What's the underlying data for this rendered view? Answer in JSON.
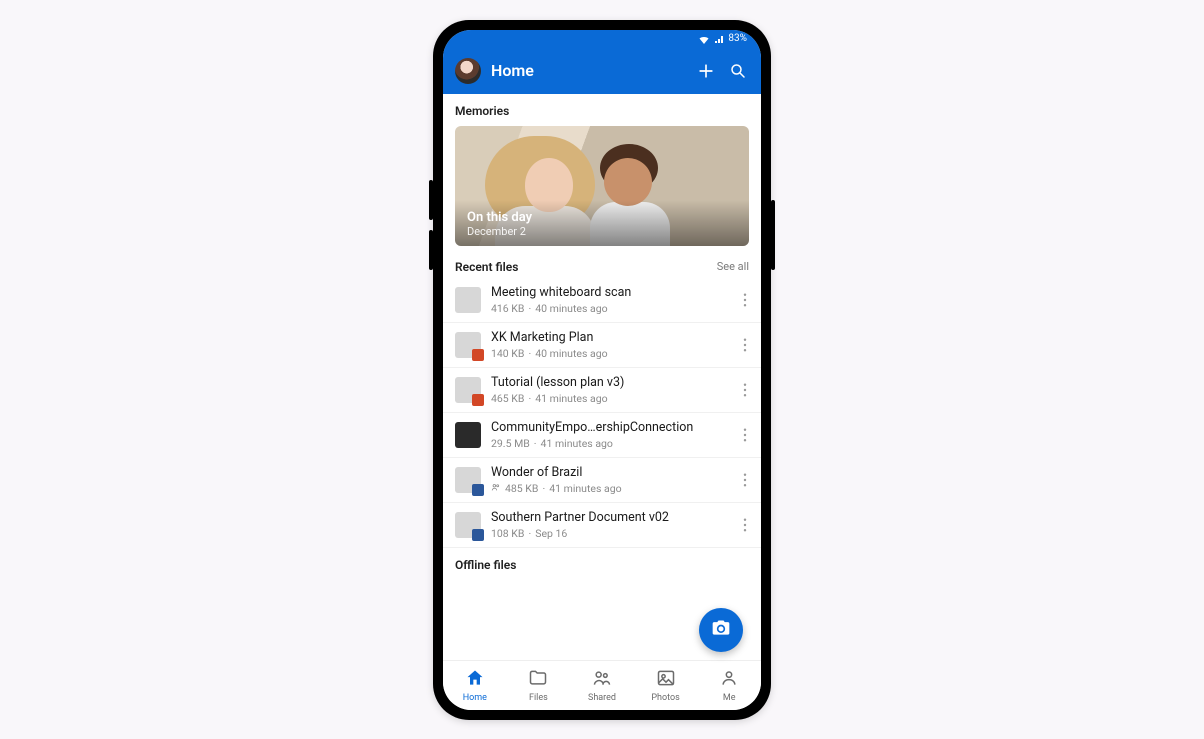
{
  "status": {
    "battery": "83%"
  },
  "header": {
    "title": "Home"
  },
  "memories": {
    "section_label": "Memories",
    "title": "On this day",
    "date": "December 2"
  },
  "recent": {
    "label": "Recent files",
    "see_all": "See all",
    "files": [
      {
        "name": "Meeting whiteboard scan",
        "size": "416 KB",
        "time": "40 minutes ago",
        "shared": false,
        "thumb": "plain"
      },
      {
        "name": "XK Marketing Plan",
        "size": "140 KB",
        "time": "40 minutes ago",
        "shared": false,
        "thumb": "ppt"
      },
      {
        "name": "Tutorial (lesson plan v3)",
        "size": "465 KB",
        "time": "41 minutes ago",
        "shared": false,
        "thumb": "ppt"
      },
      {
        "name": "CommunityEmpo…ershipConnection",
        "size": "29.5 MB",
        "time": "41 minutes ago",
        "shared": false,
        "thumb": "dark"
      },
      {
        "name": "Wonder of Brazil",
        "size": "485 KB",
        "time": "41 minutes ago",
        "shared": true,
        "thumb": "word"
      },
      {
        "name": "Southern Partner Document v02",
        "size": "108 KB",
        "time": "Sep 16",
        "shared": false,
        "thumb": "word"
      }
    ]
  },
  "offline": {
    "label": "Offline files"
  },
  "nav": {
    "items": [
      {
        "label": "Home"
      },
      {
        "label": "Files"
      },
      {
        "label": "Shared"
      },
      {
        "label": "Photos"
      },
      {
        "label": "Me"
      }
    ]
  },
  "colors": {
    "primary": "#0a6ad6"
  }
}
